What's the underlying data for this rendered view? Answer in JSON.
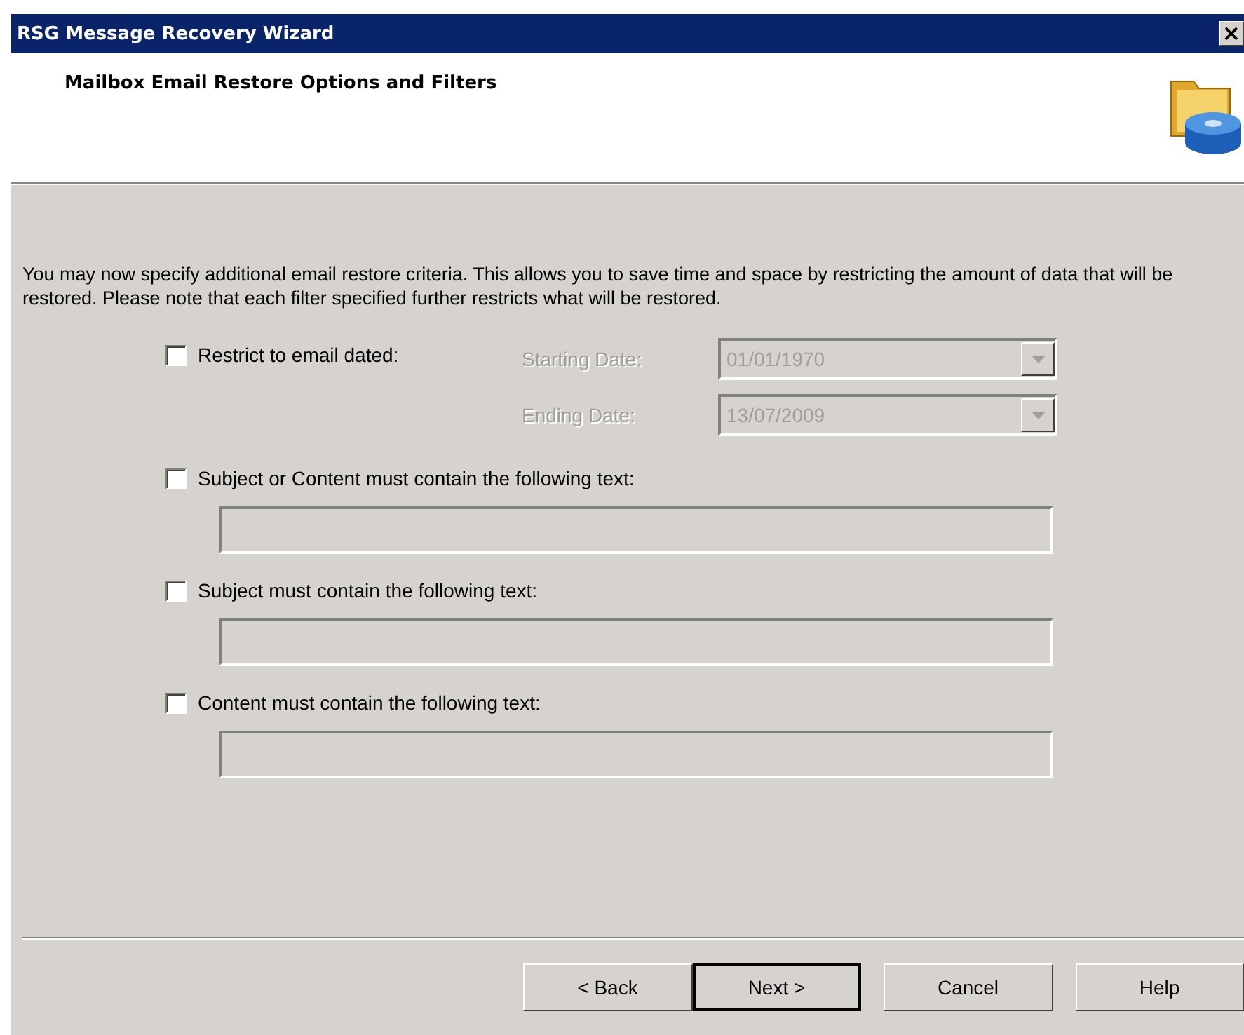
{
  "window": {
    "title": "RSG Message Recovery Wizard",
    "close": "×"
  },
  "header": {
    "title": "Mailbox Email Restore Options and Filters"
  },
  "intro": "You may now specify additional email restore criteria. This allows you to save time and space by restricting the amount of data that will be restored.  Please note that each filter specified further restricts what will be restored.",
  "date_filter": {
    "label": "Restrict to email dated:",
    "checked": false,
    "dates": [
      {
        "label": "Starting Date:",
        "value": "01/01/1970",
        "disabled": true
      },
      {
        "label": "Ending Date:",
        "value": "13/07/2009",
        "disabled": true
      }
    ]
  },
  "text_filters": [
    {
      "label": "Subject or Content must contain the following text:",
      "checked": false,
      "disabled": true
    },
    {
      "label": "Subject must contain the following text:",
      "checked": false,
      "disabled": true
    },
    {
      "label": "Content must contain the following text:",
      "checked": false,
      "disabled": true
    }
  ],
  "buttons": [
    {
      "label": "< Back",
      "default": false
    },
    {
      "label": "Next >",
      "default": true
    },
    {
      "label": "Cancel",
      "default": false
    },
    {
      "label": "Help",
      "default": false
    }
  ]
}
